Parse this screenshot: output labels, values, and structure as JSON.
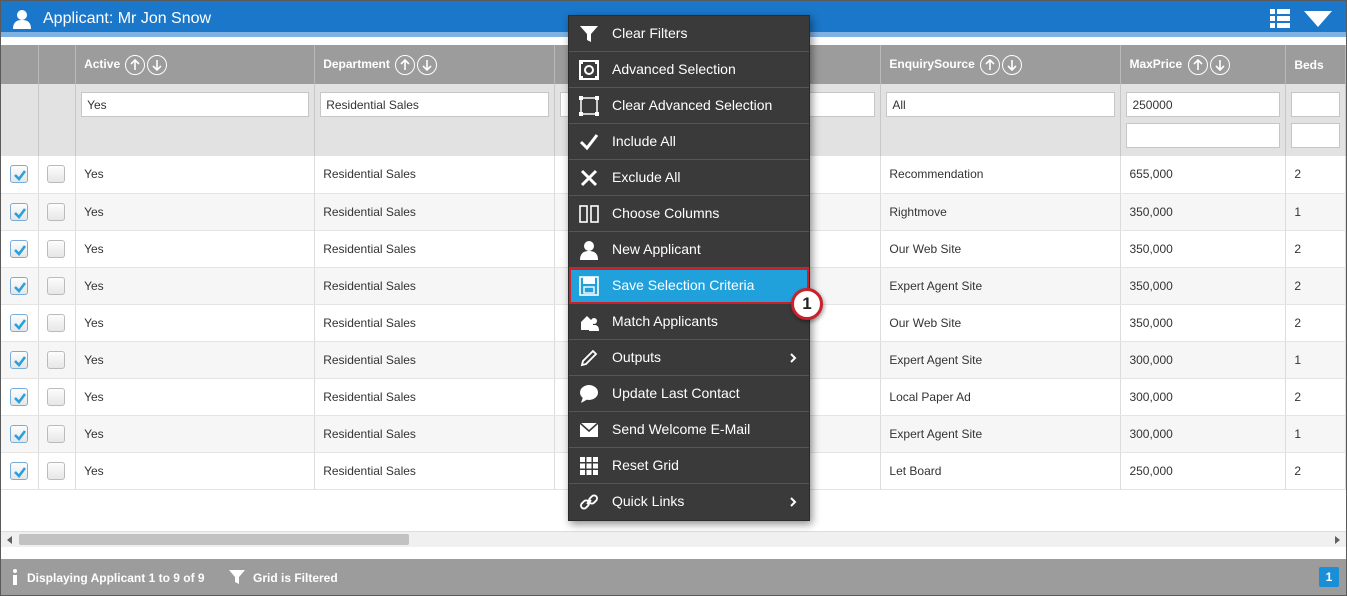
{
  "titlebar": {
    "title": "Applicant: Mr Jon Snow"
  },
  "columns": [
    {
      "key": "active",
      "label": "Active",
      "filter": "Yes",
      "filter2": null
    },
    {
      "key": "department",
      "label": "Department",
      "filter": "Residential Sales",
      "filter2": null
    },
    {
      "key": "hidden1",
      "label": "",
      "filter": "",
      "filter2": null
    },
    {
      "key": "hidden2",
      "label": "",
      "filter": "",
      "filter2": null
    },
    {
      "key": "enquiry_source",
      "label": "EnquirySource",
      "filter": "All",
      "filter2": null
    },
    {
      "key": "max_price",
      "label": "MaxPrice",
      "filter": "250000",
      "filter2": ""
    },
    {
      "key": "beds",
      "label": "Beds",
      "filter": "",
      "filter2": ""
    }
  ],
  "rows": [
    {
      "active": "Yes",
      "department": "Residential Sales",
      "enquiry_source": "Recommendation",
      "max_price": "655,000",
      "beds": "2"
    },
    {
      "active": "Yes",
      "department": "Residential Sales",
      "enquiry_source": "Rightmove",
      "max_price": "350,000",
      "beds": "1"
    },
    {
      "active": "Yes",
      "department": "Residential Sales",
      "enquiry_source": "Our Web Site",
      "max_price": "350,000",
      "beds": "2"
    },
    {
      "active": "Yes",
      "department": "Residential Sales",
      "enquiry_source": "Expert Agent Site",
      "max_price": "350,000",
      "beds": "2"
    },
    {
      "active": "Yes",
      "department": "Residential Sales",
      "enquiry_source": "Our Web Site",
      "max_price": "350,000",
      "beds": "2"
    },
    {
      "active": "Yes",
      "department": "Residential Sales",
      "enquiry_source": "Expert Agent Site",
      "max_price": "300,000",
      "beds": "1"
    },
    {
      "active": "Yes",
      "department": "Residential Sales",
      "enquiry_source": "Local Paper Ad",
      "max_price": "300,000",
      "beds": "2"
    },
    {
      "active": "Yes",
      "department": "Residential Sales",
      "enquiry_source": "Expert Agent Site",
      "max_price": "300,000",
      "beds": "1"
    },
    {
      "active": "Yes",
      "department": "Residential Sales",
      "enquiry_source": "Let Board",
      "max_price": "250,000",
      "beds": "2"
    }
  ],
  "menu": {
    "items": [
      {
        "label": "Clear Filters",
        "icon": "filter-icon"
      },
      {
        "label": "Advanced Selection",
        "icon": "advanced-selection-icon"
      },
      {
        "label": "Clear Advanced Selection",
        "icon": "clear-selection-icon"
      },
      {
        "label": "Include All",
        "icon": "checkmark-icon"
      },
      {
        "label": "Exclude All",
        "icon": "x-icon"
      },
      {
        "label": "Choose Columns",
        "icon": "columns-icon"
      },
      {
        "label": "New Applicant",
        "icon": "user-icon"
      },
      {
        "label": "Save Selection Criteria",
        "icon": "save-icon",
        "active": true
      },
      {
        "label": "Match Applicants",
        "icon": "match-icon"
      },
      {
        "label": "Outputs",
        "icon": "pencil-icon",
        "submenu": true
      },
      {
        "label": "Update Last Contact",
        "icon": "speech-bubble-icon"
      },
      {
        "label": "Send Welcome E-Mail",
        "icon": "envelope-icon"
      },
      {
        "label": "Reset Grid",
        "icon": "grid-icon"
      },
      {
        "label": "Quick Links",
        "icon": "link-icon",
        "submenu": true
      }
    ]
  },
  "callout": "1",
  "status": {
    "displaying": "Displaying Applicant 1 to 9 of 9",
    "filtered": "Grid is Filtered",
    "page": "1"
  },
  "colors": {
    "header_blue": "#1a77c9",
    "grid_header": "#9c9c9c",
    "menu_bg": "#3a3a3a",
    "menu_active": "#20a1dc",
    "highlight_red": "#c9202a",
    "check_blue": "#2aa0de"
  }
}
